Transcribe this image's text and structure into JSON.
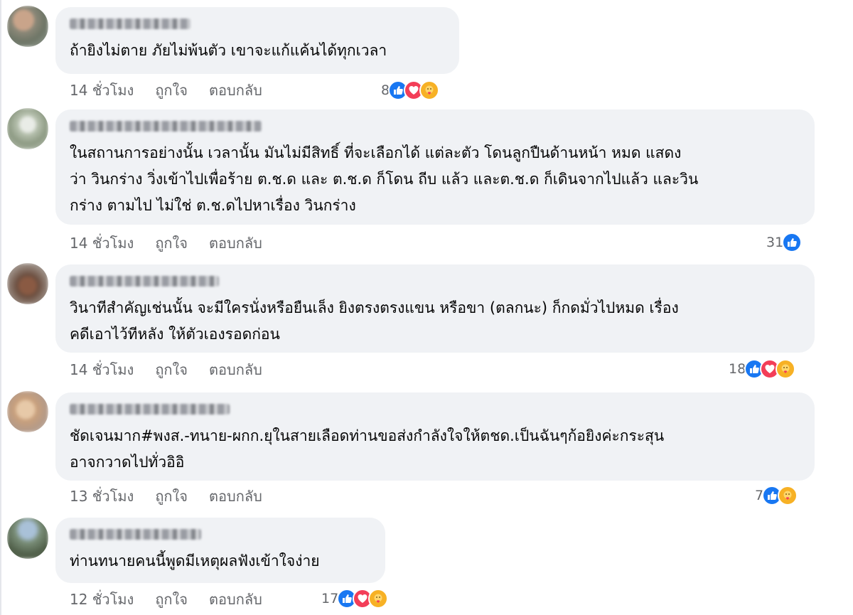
{
  "colors": {
    "bubble": "#f0f2f5",
    "meta_text": "#65676b",
    "like": "#1877f2",
    "love": "#f33e58",
    "care": "#f7b125"
  },
  "comments": [
    {
      "author": "",
      "text": "ถ้ายิงไม่ตาย ภัยไม่พ้นตัว เขาจะแก้แค้นได้ทุกเวลา",
      "time": "14 ชั่วโมง",
      "like_label": "ถูกใจ",
      "reply_label": "ตอบกลับ",
      "reaction_count": "8",
      "reactions": [
        "like-icon",
        "love-icon",
        "care-icon"
      ]
    },
    {
      "author": "",
      "text": "ในสถานการอย่างนั้น เวลานั้น มันไม่มีสิทธิ์ ที่จะเลือกได้ แต่ละตัว โดนลูกปืนด้านหน้า หมด แสดง\nว่า วินกร่าง วิ่งเข้าไปเพื่อร้าย ต.ช.ด และ ต.ช.ด ก็โดน ถีบ แล้ว และต.ช.ด ก็เดินจากไปแล้ว และวิน\nกร่าง ตามไป ไม่ใช่ ต.ช.ดไปหาเรื่อง วินกร่าง",
      "time": "14 ชั่วโมง",
      "like_label": "ถูกใจ",
      "reply_label": "ตอบกลับ",
      "reaction_count": "31",
      "reactions": [
        "like-icon"
      ]
    },
    {
      "author": "",
      "text": "วินาทีสำคัญเช่นนั้น จะมีใครนั่งหรือยืนเล็ง ยิงตรงตรงแขน หรือขา (ตลกนะ) ก็กดมั่วไปหมด เรื่อง\nคดีเอาไว้ทีหลัง ให้ตัวเองรอดก่อน",
      "time": "14 ชั่วโมง",
      "like_label": "ถูกใจ",
      "reply_label": "ตอบกลับ",
      "reaction_count": "18",
      "reactions": [
        "like-icon",
        "love-icon",
        "care-icon"
      ]
    },
    {
      "author": "",
      "text": "ชัดเจนมาก#พงส.-ทนาย-ผกก.ยุในสายเลือดท่านขอส่งกำลังใจให้ตชด.เป็นฉันๆก้อยิงค่ะกระสุน\nอาจกวาดไปทั่วอิอิ",
      "time": "13 ชั่วโมง",
      "like_label": "ถูกใจ",
      "reply_label": "ตอบกลับ",
      "reaction_count": "7",
      "reactions": [
        "like-icon",
        "care-icon"
      ]
    },
    {
      "author": "",
      "text": "ท่านทนายคนนี้พูดมีเหตุผลฟังเข้าใจง่าย",
      "time": "12 ชั่วโมง",
      "like_label": "ถูกใจ",
      "reply_label": "ตอบกลับ",
      "reaction_count": "17",
      "reactions": [
        "like-icon",
        "love-icon",
        "care-icon"
      ]
    }
  ]
}
